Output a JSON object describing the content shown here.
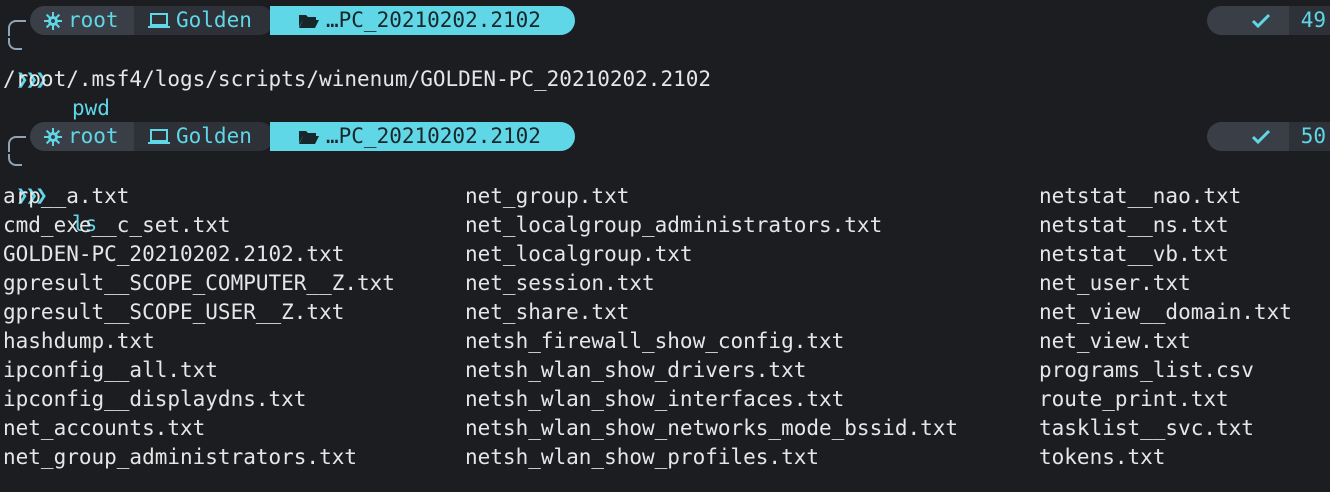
{
  "prompts": [
    {
      "user": "root",
      "user_icon": "gear-icon",
      "host": "Golden",
      "host_icon": "laptop-icon",
      "dir": "…PC_20210202.2102",
      "dir_icon": "folder-open-icon",
      "status_icon": "check-icon",
      "status_count": "49",
      "arrow": "❯❯❯",
      "command": "pwd"
    },
    {
      "user": "root",
      "user_icon": "gear-icon",
      "host": "Golden",
      "host_icon": "laptop-icon",
      "dir": "…PC_20210202.2102",
      "dir_icon": "folder-open-icon",
      "status_icon": "check-icon",
      "status_count": "50",
      "arrow": "❯❯❯",
      "command": "ls"
    }
  ],
  "pwd_output": "/root/.msf4/logs/scripts/winenum/GOLDEN-PC_20210202.2102",
  "ls_output": {
    "col1": [
      "arp__a.txt",
      "cmd_exe__c_set.txt",
      "GOLDEN-PC_20210202.2102.txt",
      "gpresult__SCOPE_COMPUTER__Z.txt",
      "gpresult__SCOPE_USER__Z.txt",
      "hashdump.txt",
      "ipconfig__all.txt",
      "ipconfig__displaydns.txt",
      "net_accounts.txt",
      "net_group_administrators.txt"
    ],
    "col2": [
      "net_group.txt",
      "net_localgroup_administrators.txt",
      "net_localgroup.txt",
      "net_session.txt",
      "net_share.txt",
      "netsh_firewall_show_config.txt",
      "netsh_wlan_show_drivers.txt",
      "netsh_wlan_show_interfaces.txt",
      "netsh_wlan_show_networks_mode_bssid.txt",
      "netsh_wlan_show_profiles.txt"
    ],
    "col3": [
      "netstat__nao.txt",
      "netstat__ns.txt",
      "netstat__vb.txt",
      "net_user.txt",
      "net_view__domain.txt",
      "net_view.txt",
      "programs_list.csv",
      "route_print.txt",
      "tasklist__svc.txt",
      "tokens.txt"
    ]
  },
  "colors": {
    "background": "#1b1d21",
    "accent": "#5fd7e7",
    "segment_dark": "#3a3f47",
    "segment_darker": "#2e3238",
    "text": "#e6e6e6"
  }
}
